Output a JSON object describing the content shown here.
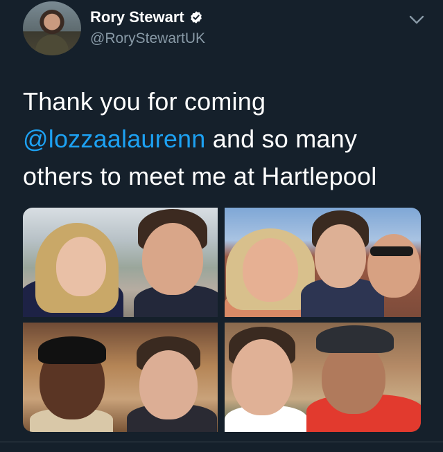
{
  "tweet": {
    "display_name": "Rory Stewart",
    "handle": "@RoryStewartUK",
    "verified_icon": "verified-badge-icon",
    "menu_icon": "chevron-down-icon",
    "text_lines": [
      "Thank you for coming",
      "@lozzaalaurenn",
      " and so many",
      "others to meet me at Hartlepool"
    ],
    "mention_color": "#1da1f2",
    "background_color": "#15202b"
  }
}
